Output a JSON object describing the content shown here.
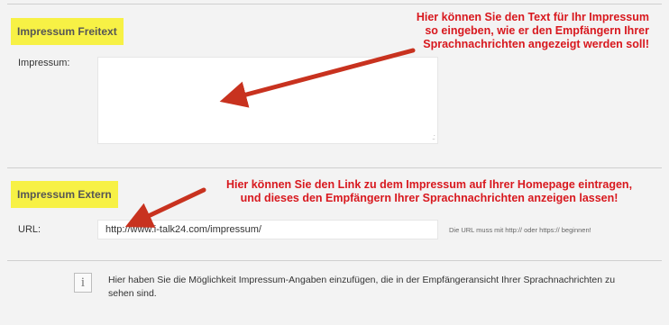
{
  "sections": {
    "freitext": {
      "title": "Impressum Freitext",
      "field_label": "Impressum:",
      "textarea_value": ""
    },
    "extern": {
      "title": "Impressum Extern",
      "field_label": "URL:",
      "url_value": "http://www.i-talk24.com/impressum/",
      "url_hint": "Die URL muss mit http:// oder https:// beginnen!"
    }
  },
  "annotations": {
    "freitext": [
      "Hier können Sie den Text für Ihr Impressum",
      "so eingeben, wie er den Empfängern Ihrer",
      "Sprachnachrichten angezeigt werden soll!"
    ],
    "extern": [
      "Hier können Sie den Link zu dem Impressum auf Ihrer Homepage eintragen,",
      "und dieses den Empfängern Ihrer Sprachnachrichten anzeigen lassen!"
    ]
  },
  "info": {
    "icon": "info-icon",
    "text": "Hier haben Sie die Möglichkeit Impressum-Angaben einzufügen, die in der Empfängeransicht Ihrer Sprachnachrichten zu sehen sind."
  },
  "colors": {
    "highlight": "#f7f145",
    "annotation": "#d8181e",
    "arrow": "#c8321f",
    "background": "#f3f3f3"
  }
}
